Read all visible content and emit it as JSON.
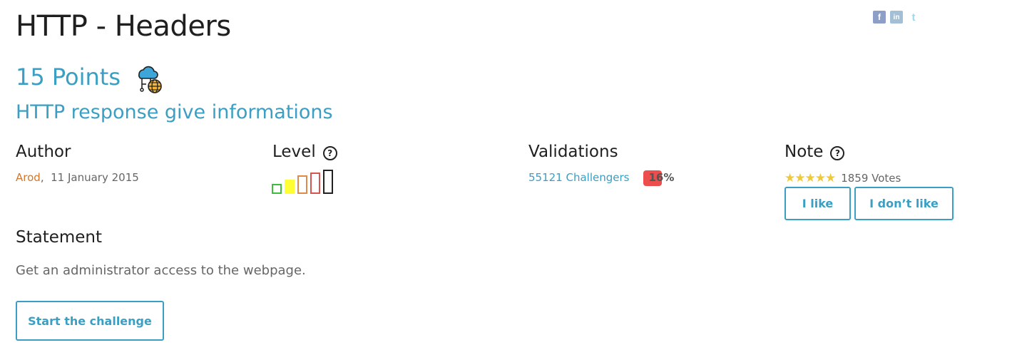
{
  "challenge": {
    "title": "HTTP - Headers",
    "points": "15 Points",
    "category_icon": "cloud-network-globe-icon",
    "subtitle": "HTTP response give informations"
  },
  "social": [
    {
      "name": "facebook-icon",
      "glyph": "f"
    },
    {
      "name": "linkedin-icon",
      "glyph": "in"
    },
    {
      "name": "twitter-icon",
      "glyph": "t"
    }
  ],
  "author": {
    "heading": "Author",
    "name": "Arod",
    "date": "11 January 2015"
  },
  "level": {
    "heading": "Level",
    "help": "?",
    "selected": 2,
    "bars": [
      {
        "color": "#3dbf3d"
      },
      {
        "color": "#ffff33"
      },
      {
        "color": "#e08a4a"
      },
      {
        "color": "#d9534f"
      },
      {
        "color": "#222222"
      }
    ]
  },
  "validations": {
    "heading": "Validations",
    "challengers": "55121 Challengers",
    "percent": "16%"
  },
  "note": {
    "heading": "Note",
    "help": "?",
    "stars": "★★★★★",
    "votes": "1859 Votes",
    "like_label": "I like",
    "dislike_label": "I don’t like"
  },
  "statement": {
    "heading": "Statement",
    "text": "Get an administrator access to the webpage."
  },
  "start_label": "Start the challenge",
  "colors": {
    "accent": "#3a9fc3",
    "author": "#d0782d",
    "badge": "#ec4d4d",
    "stars": "#f0c93b"
  }
}
